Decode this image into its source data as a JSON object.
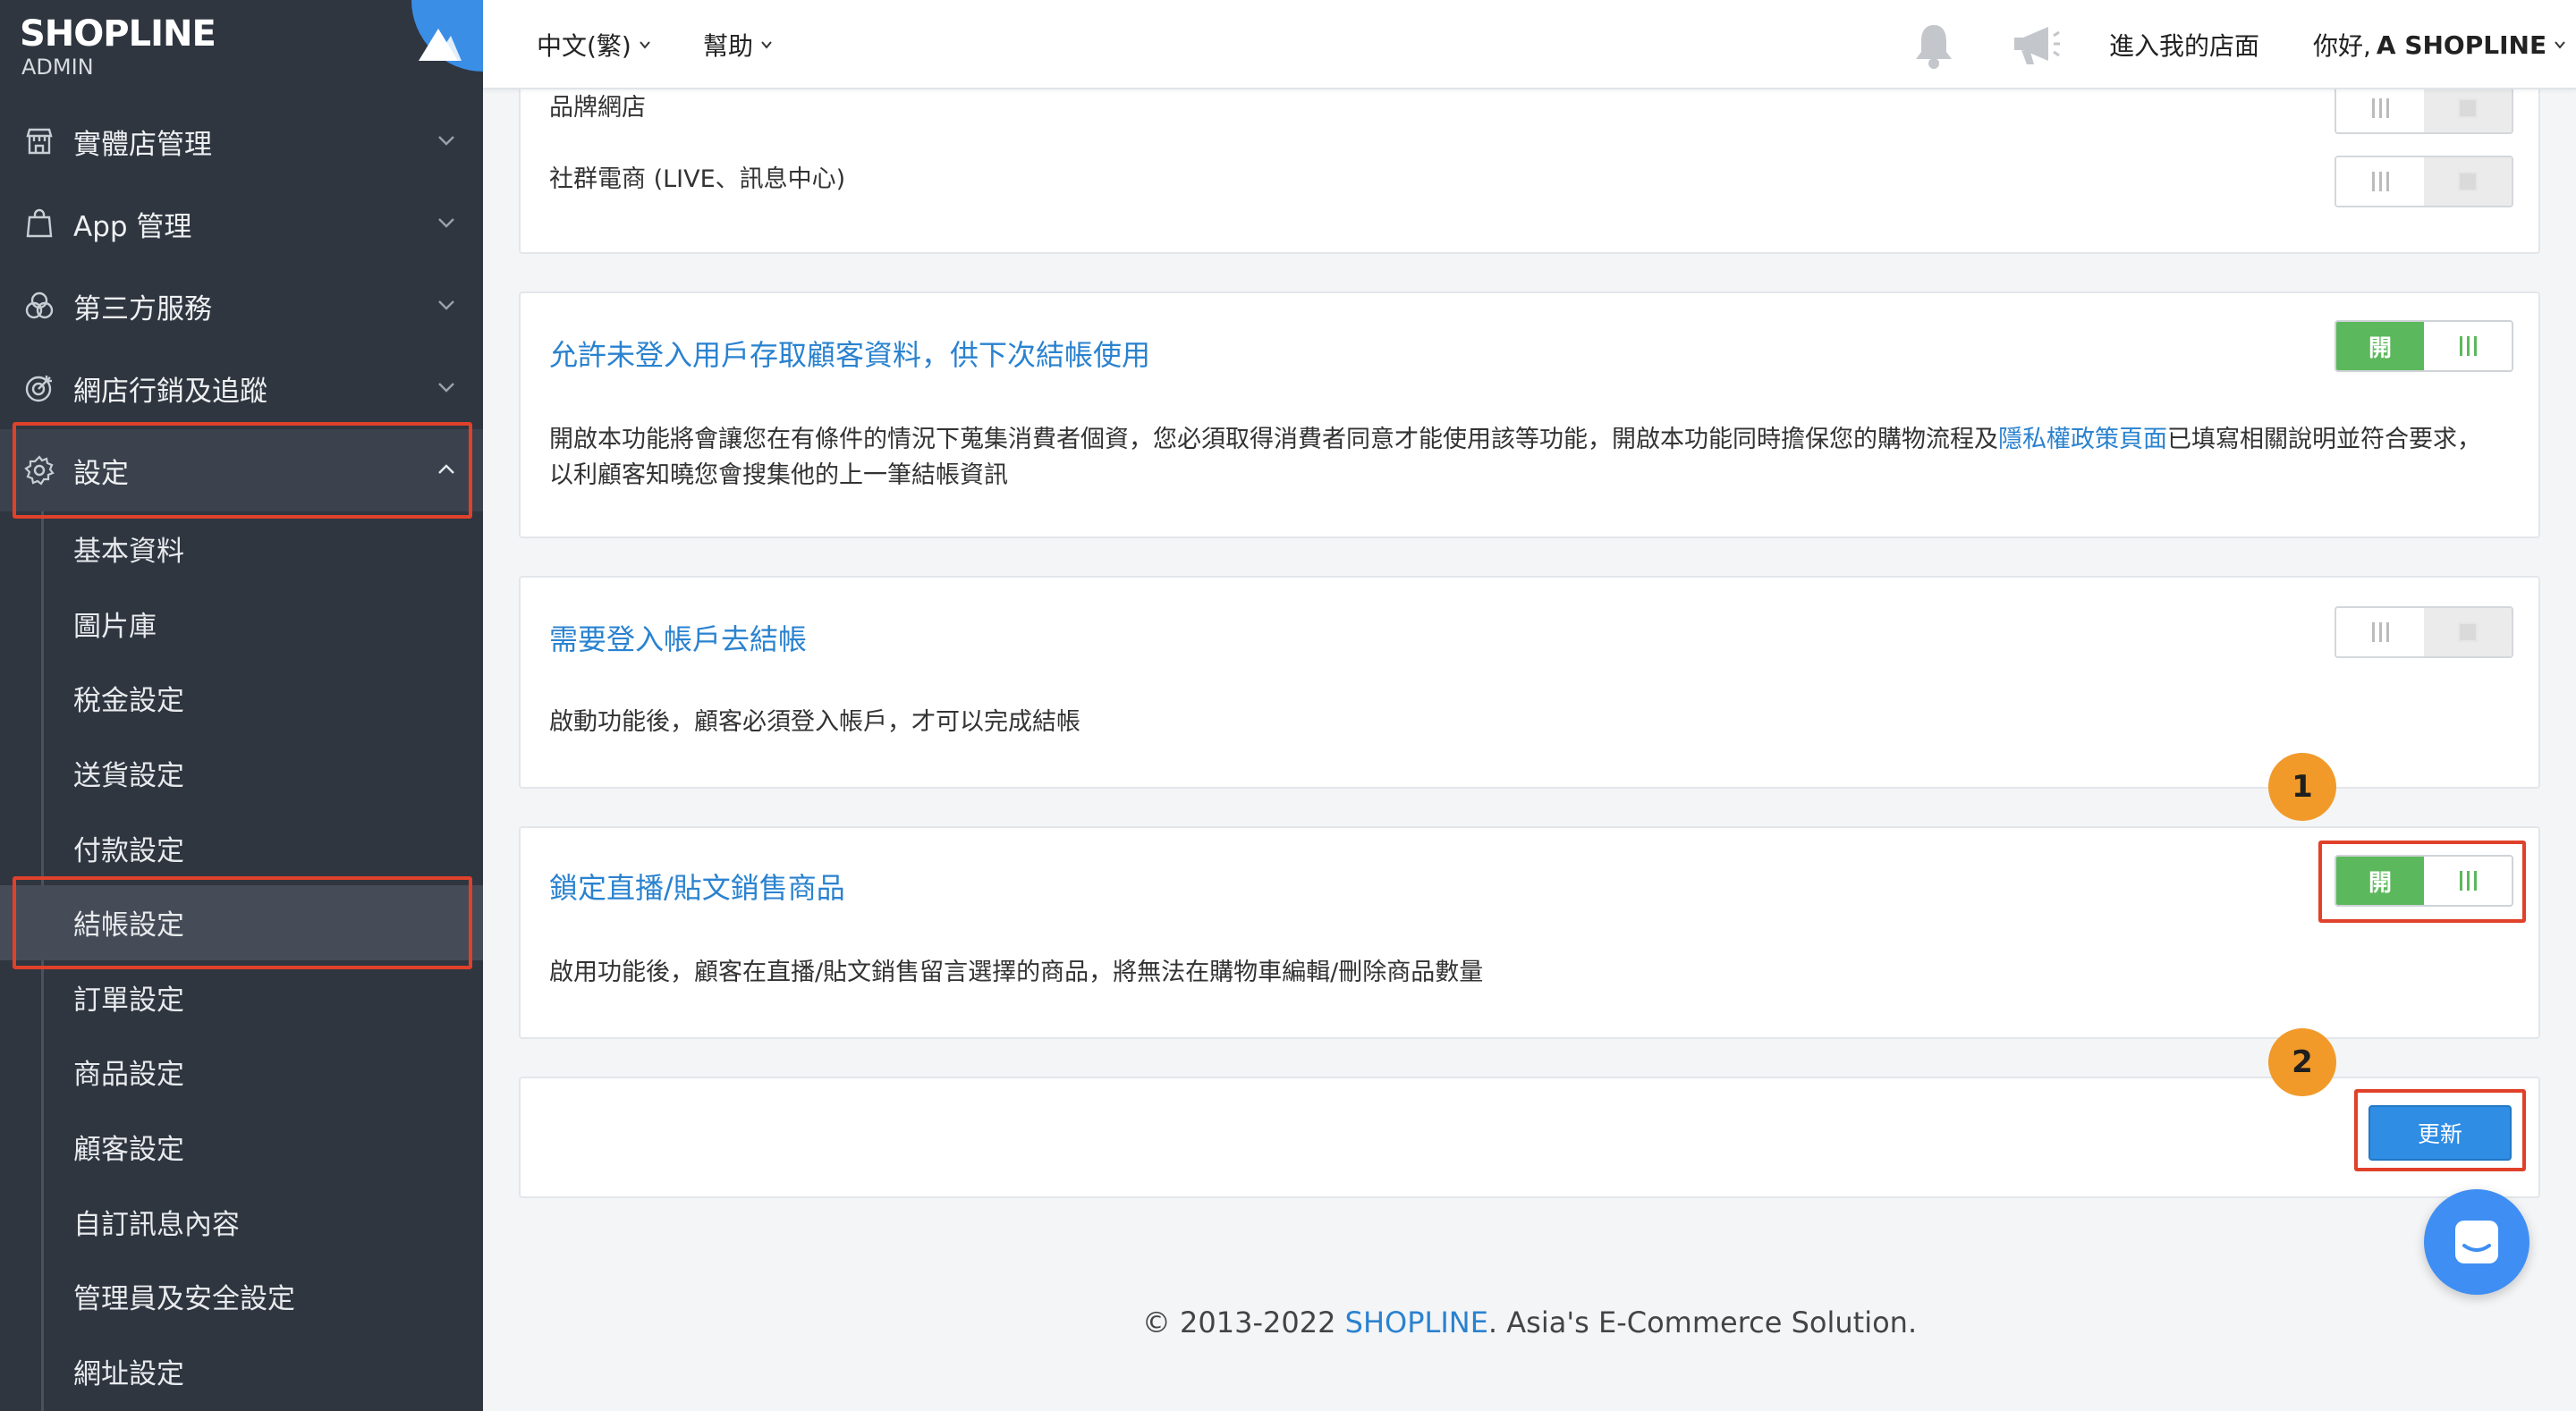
{
  "brand": {
    "logo": "SHOPLINE",
    "sub": "ADMIN"
  },
  "sidebar": {
    "items": [
      {
        "label": "實體店管理",
        "icon": "store-icon"
      },
      {
        "label": "App 管理",
        "icon": "shopping-bag-icon"
      },
      {
        "label": "第三方服務",
        "icon": "circles-icon"
      },
      {
        "label": "網店行銷及追蹤",
        "icon": "target-icon"
      },
      {
        "label": "設定",
        "icon": "gear-icon"
      }
    ],
    "sub_items": [
      "基本資料",
      "圖片庫",
      "稅金設定",
      "送貨設定",
      "付款設定",
      "結帳設定",
      "訂單設定",
      "商品設定",
      "顧客設定",
      "自訂訊息內容",
      "管理員及安全設定",
      "網址設定"
    ]
  },
  "header": {
    "language": "中文(繁)",
    "help": "幫助",
    "store_link": "進入我的店面",
    "greeting_prefix": "你好, ",
    "greeting_name": "A SHOPLINE"
  },
  "channels": {
    "rows": [
      {
        "label": "品牌網店",
        "state": "off"
      },
      {
        "label": "社群電商 (LIVE、訊息中心)",
        "state": "off"
      }
    ]
  },
  "settings": [
    {
      "title": "允許未登入用戶存取顧客資料，供下次結帳使用",
      "state": "on",
      "toggle_label": "開",
      "desc_before": "開啟本功能將會讓您在有條件的情況下蒐集消費者個資，您必須取得消費者同意才能使用該等功能，開啟本功能同時擔保您的購物流程及",
      "desc_link": "隱私權政策頁面",
      "desc_after": "已填寫相關說明並符合要求，以利顧客知曉您會搜集他的上一筆結帳資訊"
    },
    {
      "title": "需要登入帳戶去結帳",
      "state": "off",
      "desc": "啟動功能後，顧客必須登入帳戶，才可以完成結帳"
    },
    {
      "title": "鎖定直播/貼文銷售商品",
      "state": "on",
      "toggle_label": "開",
      "desc": "啟用功能後，顧客在直播/貼文銷售留言選擇的商品，將無法在購物車編輯/刪除商品數量"
    }
  ],
  "annotations": {
    "badge1": "1",
    "badge2": "2"
  },
  "actions": {
    "update_label": "更新"
  },
  "footer": {
    "prefix": "© 2013-2022 ",
    "brand": "SHOPLINE",
    "suffix": ". Asia's E-Commerce Solution."
  },
  "colors": {
    "sidebar": "#2f3640",
    "accent": "#2a82cf",
    "toggle_on": "#5cb85c",
    "highlight": "#e0412a",
    "badge": "#f19a2a",
    "button": "#2f8de4"
  }
}
